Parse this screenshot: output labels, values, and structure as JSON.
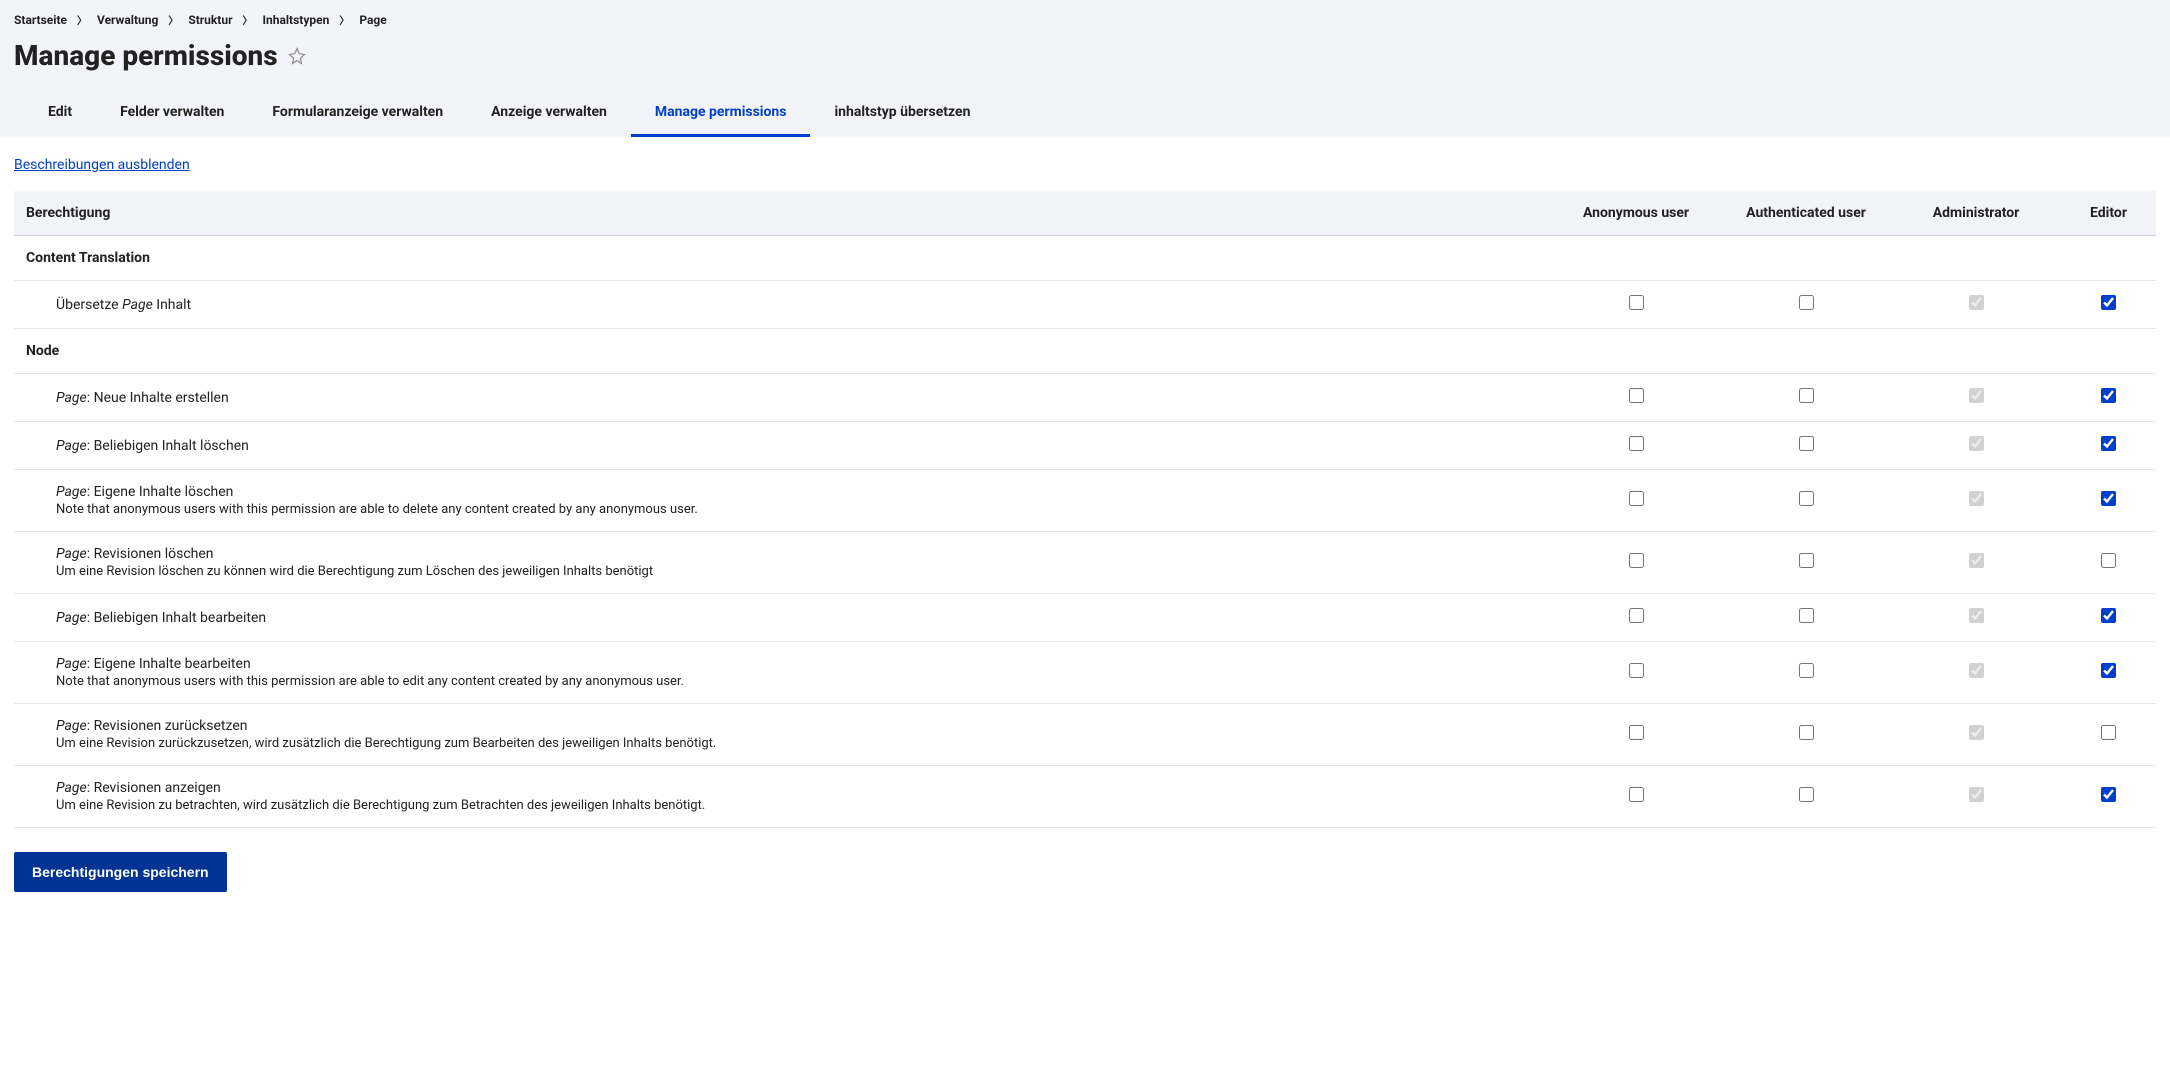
{
  "breadcrumb": {
    "items": [
      "Startseite",
      "Verwaltung",
      "Struktur",
      "Inhaltstypen",
      "Page"
    ]
  },
  "page_title": "Manage permissions",
  "tabs": {
    "items": [
      {
        "label": "Edit",
        "active": false
      },
      {
        "label": "Felder verwalten",
        "active": false
      },
      {
        "label": "Formularanzeige verwalten",
        "active": false
      },
      {
        "label": "Anzeige verwalten",
        "active": false
      },
      {
        "label": "Manage permissions",
        "active": true
      },
      {
        "label": "inhaltstyp übersetzen",
        "active": false
      }
    ]
  },
  "hide_descriptions": "Beschreibungen ausblenden",
  "table": {
    "header_permission": "Berechtigung",
    "roles": [
      "Anonymous user",
      "Authenticated user",
      "Administrator",
      "Editor"
    ]
  },
  "sections": [
    {
      "title": "Content Translation",
      "rows": [
        {
          "label_prefix": "Übersetze ",
          "label_em": "Page",
          "label_suffix": " Inhalt",
          "desc": "",
          "checks": [
            {
              "checked": false,
              "disabled": false
            },
            {
              "checked": false,
              "disabled": false
            },
            {
              "checked": true,
              "disabled": true
            },
            {
              "checked": true,
              "disabled": false
            }
          ]
        }
      ]
    },
    {
      "title": "Node",
      "rows": [
        {
          "label_prefix": "",
          "label_em": "Page",
          "label_suffix": ": Neue Inhalte erstellen",
          "desc": "",
          "checks": [
            {
              "checked": false,
              "disabled": false
            },
            {
              "checked": false,
              "disabled": false
            },
            {
              "checked": true,
              "disabled": true
            },
            {
              "checked": true,
              "disabled": false
            }
          ]
        },
        {
          "label_prefix": "",
          "label_em": "Page",
          "label_suffix": ": Beliebigen Inhalt löschen",
          "desc": "",
          "checks": [
            {
              "checked": false,
              "disabled": false
            },
            {
              "checked": false,
              "disabled": false
            },
            {
              "checked": true,
              "disabled": true
            },
            {
              "checked": true,
              "disabled": false
            }
          ]
        },
        {
          "label_prefix": "",
          "label_em": "Page",
          "label_suffix": ": Eigene Inhalte löschen",
          "desc": "Note that anonymous users with this permission are able to delete any content created by any anonymous user.",
          "checks": [
            {
              "checked": false,
              "disabled": false
            },
            {
              "checked": false,
              "disabled": false
            },
            {
              "checked": true,
              "disabled": true
            },
            {
              "checked": true,
              "disabled": false
            }
          ]
        },
        {
          "label_prefix": "",
          "label_em": "Page",
          "label_suffix": ": Revisionen löschen",
          "desc": "Um eine Revision löschen zu können wird die Berechtigung zum Löschen des jeweiligen Inhalts benötigt",
          "checks": [
            {
              "checked": false,
              "disabled": false
            },
            {
              "checked": false,
              "disabled": false
            },
            {
              "checked": true,
              "disabled": true
            },
            {
              "checked": false,
              "disabled": false
            }
          ]
        },
        {
          "label_prefix": "",
          "label_em": "Page",
          "label_suffix": ": Beliebigen Inhalt bearbeiten",
          "desc": "",
          "checks": [
            {
              "checked": false,
              "disabled": false
            },
            {
              "checked": false,
              "disabled": false
            },
            {
              "checked": true,
              "disabled": true
            },
            {
              "checked": true,
              "disabled": false
            }
          ]
        },
        {
          "label_prefix": "",
          "label_em": "Page",
          "label_suffix": ": Eigene Inhalte bearbeiten",
          "desc": "Note that anonymous users with this permission are able to edit any content created by any anonymous user.",
          "checks": [
            {
              "checked": false,
              "disabled": false
            },
            {
              "checked": false,
              "disabled": false
            },
            {
              "checked": true,
              "disabled": true
            },
            {
              "checked": true,
              "disabled": false
            }
          ]
        },
        {
          "label_prefix": "",
          "label_em": "Page",
          "label_suffix": ": Revisionen zurücksetzen",
          "desc": "Um eine Revision zurückzusetzen, wird zusätzlich die Berechtigung zum Bearbeiten des jeweiligen Inhalts benötigt.",
          "checks": [
            {
              "checked": false,
              "disabled": false
            },
            {
              "checked": false,
              "disabled": false
            },
            {
              "checked": true,
              "disabled": true
            },
            {
              "checked": false,
              "disabled": false
            }
          ]
        },
        {
          "label_prefix": "",
          "label_em": "Page",
          "label_suffix": ": Revisionen anzeigen",
          "desc": "Um eine Revision zu betrachten, wird zusätzlich die Berechtigung zum Betrachten des jeweiligen Inhalts benötigt.",
          "checks": [
            {
              "checked": false,
              "disabled": false
            },
            {
              "checked": false,
              "disabled": false
            },
            {
              "checked": true,
              "disabled": true
            },
            {
              "checked": true,
              "disabled": false
            }
          ]
        }
      ]
    }
  ],
  "submit_label": "Berechtigungen speichern"
}
